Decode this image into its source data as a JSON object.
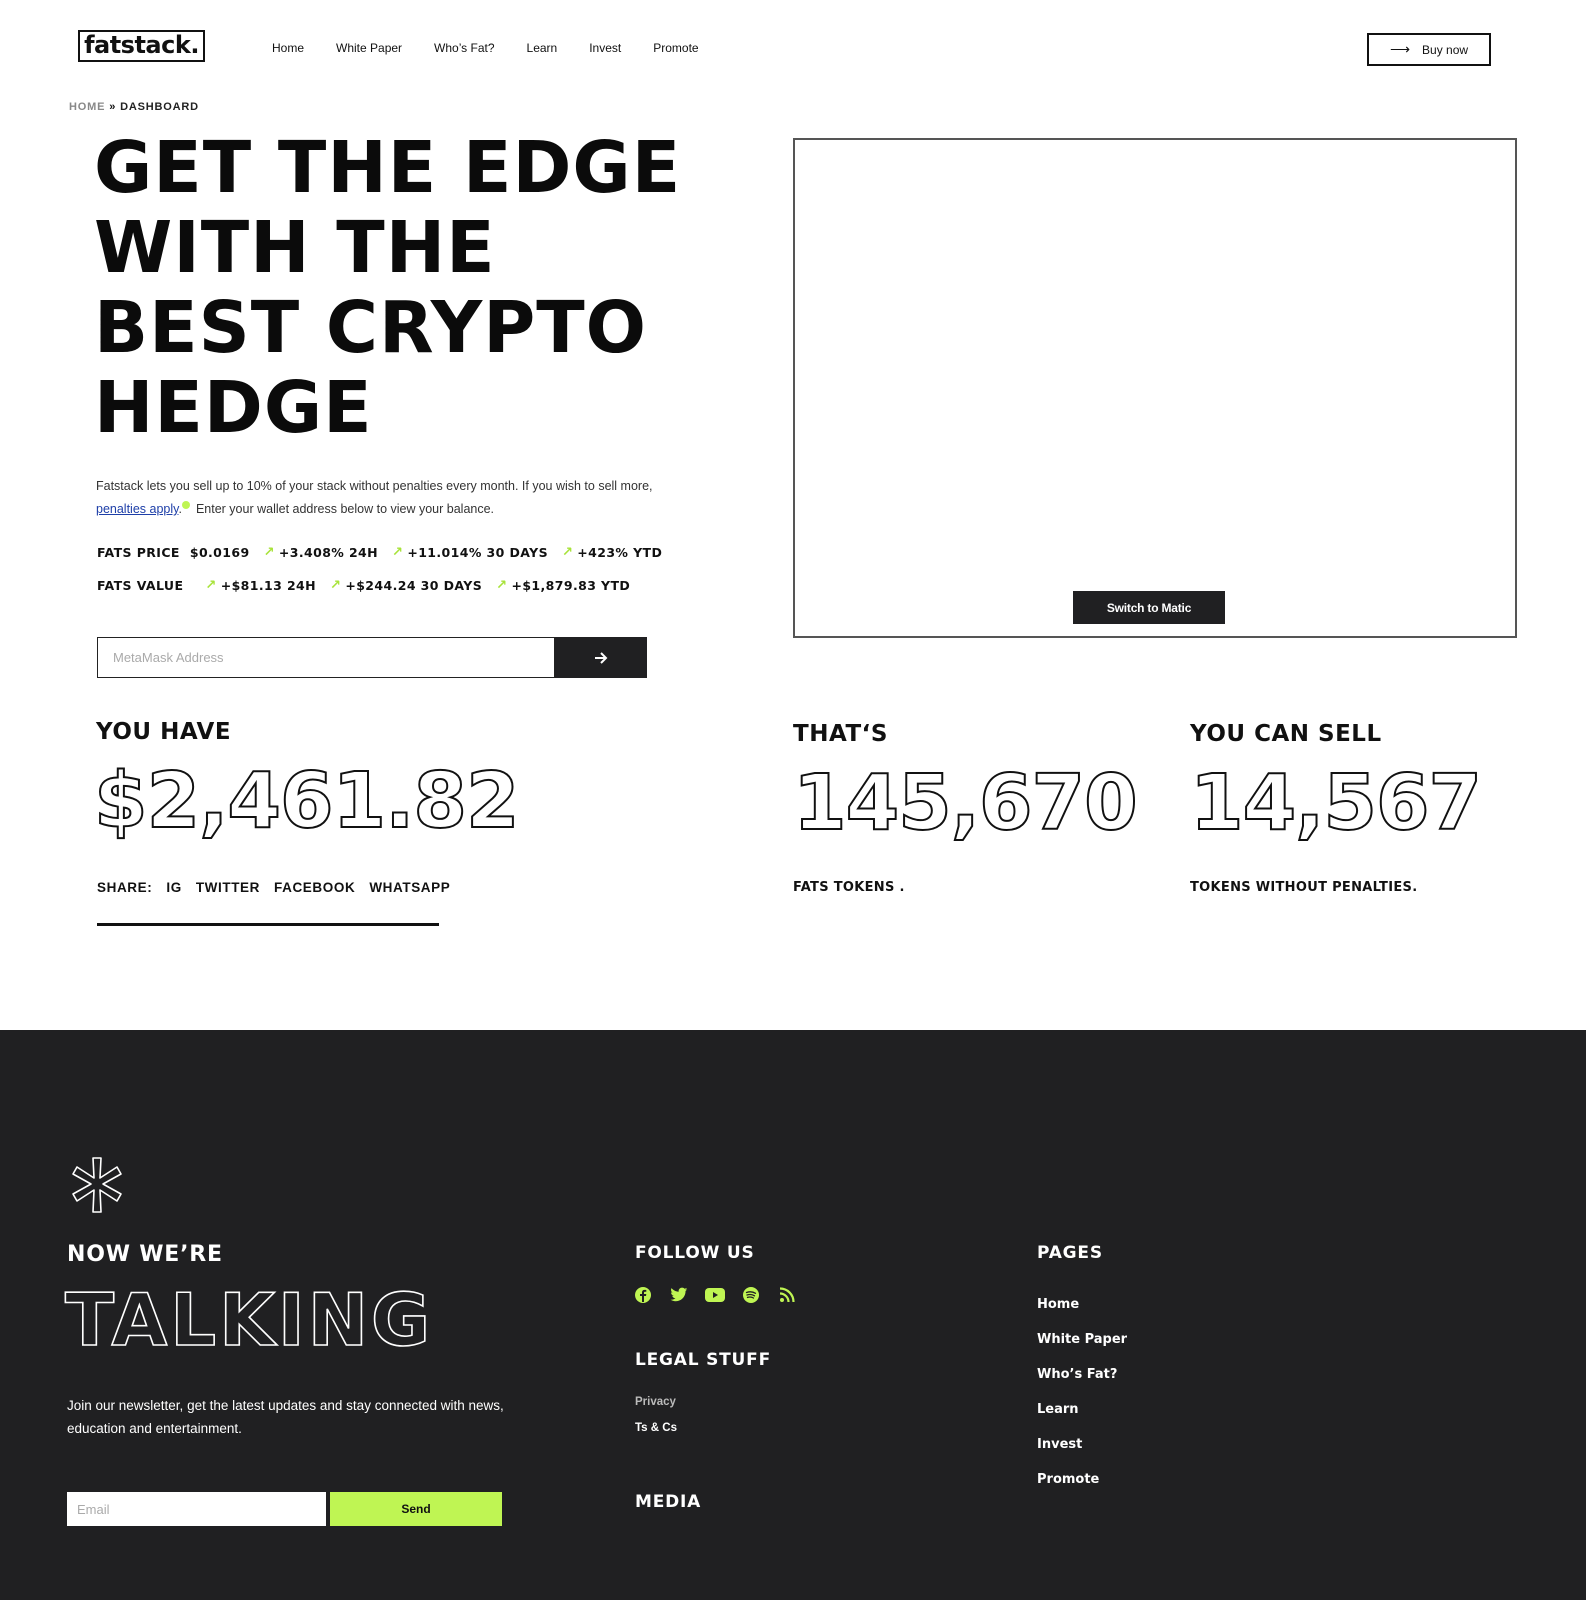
{
  "header": {
    "logo": "fatstack.",
    "nav": [
      "Home",
      "White Paper",
      "Who’s Fat?",
      "Learn",
      "Invest",
      "Promote"
    ],
    "buy_label": "Buy now"
  },
  "breadcrumb": {
    "home": "HOME",
    "separator": "»",
    "current": "DASHBOARD"
  },
  "hero": {
    "title_lines": [
      "GET THE EDGE",
      "WITH THE",
      "BEST CRYPTO",
      "HEDGE"
    ],
    "intro_before_link": "Fatstack lets you sell up to 10% of your stack without penalties every month. If you wish to sell more, ",
    "intro_link": "penalties apply",
    "intro_after_link": ".",
    "intro_tail": "Enter your wallet address below to view your balance."
  },
  "stats": {
    "price_label": "FATS PRICE",
    "price_value": "$0.0169",
    "price_changes": [
      "+3.408% 24H",
      "+11.014% 30 DAYS",
      "+423% YTD"
    ],
    "value_label": "FATS VALUE",
    "value_changes": [
      "+$81.13 24H",
      "+$244.24 30 DAYS",
      "+$1,879.83 YTD"
    ]
  },
  "wallet": {
    "placeholder": "MetaMask Address",
    "go_icon": "arrow-right-icon"
  },
  "widget": {
    "switch_label": "Switch to Matic"
  },
  "balances": {
    "you_have_label": "YOU HAVE",
    "you_have_value": "$2,461.82",
    "thats_label": "THAT‘S",
    "thats_value": "145,670",
    "thats_caption": "FATS TOKENS .",
    "sell_label": "YOU CAN SELL",
    "sell_value": "14,567",
    "sell_caption": "TOKENS WITHOUT PENALTIES."
  },
  "share": {
    "label": "SHARE:",
    "links": [
      "IG",
      "TWITTER",
      "FACEBOOK",
      "WHATSAPP"
    ]
  },
  "footer": {
    "now_label": "NOW WE’RE",
    "talking": "TALKING",
    "newsletter_text": "Join our newsletter, get the latest updates and stay connected with news, education and entertainment.",
    "email_placeholder": "Email",
    "send_label": "Send",
    "follow_title": "FOLLOW US",
    "social_icons": [
      "facebook-icon",
      "twitter-icon",
      "youtube-icon",
      "spotify-icon",
      "rss-icon"
    ],
    "legal_title": "LEGAL STUFF",
    "legal_links": [
      "Privacy",
      "Ts & Cs"
    ],
    "media_title": "MEDIA",
    "pages_title": "PAGES",
    "pages": [
      "Home",
      "White Paper",
      "Who’s Fat?",
      "Learn",
      "Invest",
      "Promote"
    ]
  },
  "colors": {
    "accent": "#bff553",
    "dark": "#202022",
    "link": "#1e3fa8"
  }
}
